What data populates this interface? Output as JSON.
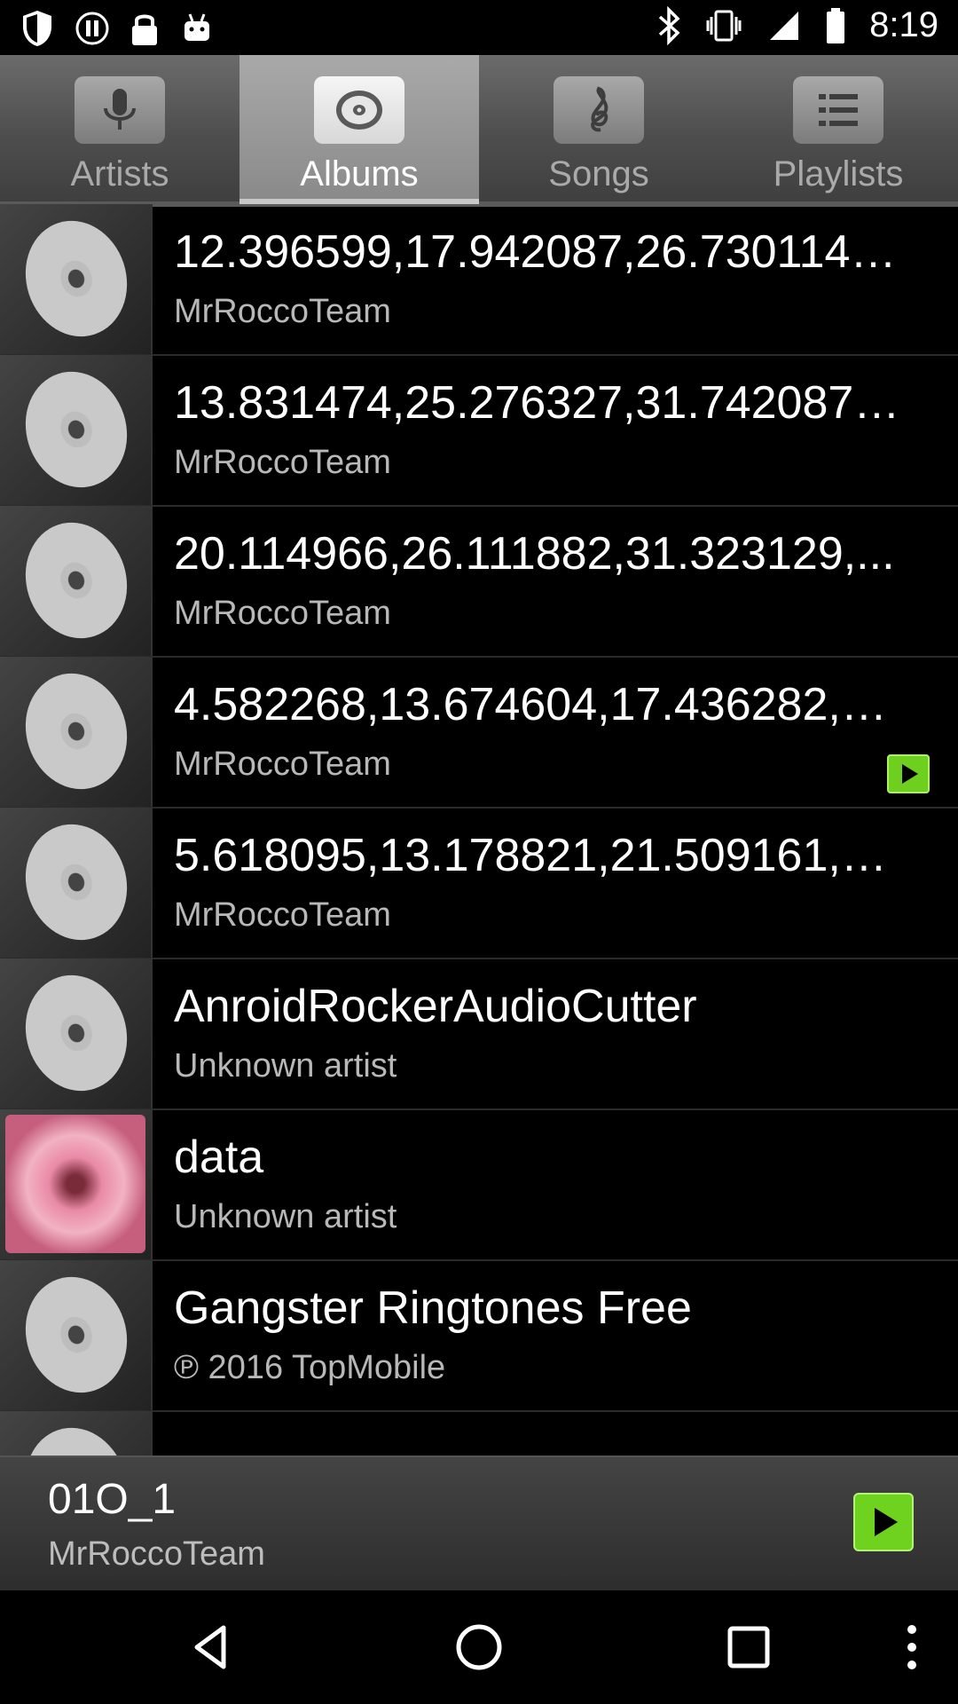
{
  "status_bar": {
    "time": "8:19",
    "left_icons": [
      "shield-icon",
      "pause-circle-icon",
      "lock-icon",
      "android-icon"
    ],
    "right_icons": [
      "bluetooth-icon",
      "vibrate-icon",
      "signal-icon",
      "battery-icon"
    ]
  },
  "tabs": [
    {
      "id": "artists",
      "label": "Artists",
      "icon": "microphone-icon",
      "active": false
    },
    {
      "id": "albums",
      "label": "Albums",
      "icon": "disc-icon",
      "active": true
    },
    {
      "id": "songs",
      "label": "Songs",
      "icon": "treble-clef-icon",
      "active": false
    },
    {
      "id": "playlists",
      "label": "Playlists",
      "icon": "list-icon",
      "active": false
    }
  ],
  "albums": [
    {
      "title": "12.396599,17.942087,26.730114,...",
      "artist": "MrRoccoTeam",
      "art": "disc"
    },
    {
      "title": "13.831474,25.276327,31.742087,...",
      "artist": "MrRoccoTeam",
      "art": "disc"
    },
    {
      "title": "20.114966,26.111882,31.323129,...",
      "artist": "MrRoccoTeam",
      "art": "disc"
    },
    {
      "title": "4.582268,13.674604,17.436282,2...",
      "artist": "MrRoccoTeam",
      "art": "disc",
      "playing": true
    },
    {
      "title": "5.618095,13.178821,21.509161,2...",
      "artist": "MrRoccoTeam",
      "art": "disc"
    },
    {
      "title": "AnroidRockerAudioCutter",
      "artist": "Unknown artist",
      "art": "disc"
    },
    {
      "title": "data",
      "artist": "Unknown artist",
      "art": "photo"
    },
    {
      "title": "Gangster Ringtones Free",
      "artist": "℗ 2016 TopMobile",
      "art": "disc"
    }
  ],
  "now_playing": {
    "title": "01O_1",
    "artist": "MrRoccoTeam",
    "play_icon": "play-icon"
  },
  "nav_bar": {
    "buttons": [
      "back-icon",
      "home-icon",
      "recents-icon",
      "overflow-menu-icon"
    ]
  },
  "colors": {
    "accent": "#6fcf1f",
    "background": "#000000"
  }
}
